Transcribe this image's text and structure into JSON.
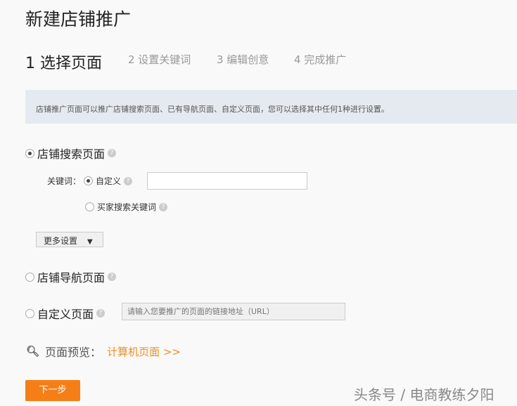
{
  "title": "新建店铺推广",
  "steps": [
    "1 选择页面",
    "2 设置关键词",
    "3 编辑创意",
    "4 完成推广"
  ],
  "info": "店铺推广页面可以推广店铺搜索页面、已有导航页面、自定义页面，您可以选择其中任何1种进行设置。",
  "options": {
    "search_page": "店铺搜索页面",
    "keyword_label": "关键词：",
    "custom": "自定义",
    "buyer_keywords": "买家搜索关键词",
    "more_settings": "更多设置",
    "nav_page": "店铺导航页面",
    "custom_page": "自定义页面",
    "url_placeholder": "请输入您要推广的页面的链接地址（URL）"
  },
  "preview": {
    "label": "页面预览：",
    "link": "计算机页面 >>"
  },
  "next": "下一步",
  "watermark": "头条号 / 电商教练夕阳",
  "help": "?"
}
